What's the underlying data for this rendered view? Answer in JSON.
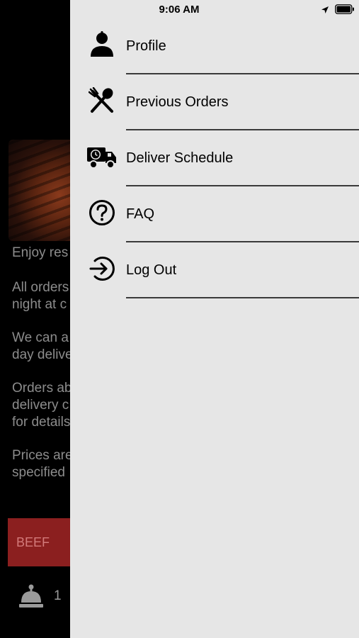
{
  "status_bar": {
    "time": "9:06 AM"
  },
  "menu": {
    "items": [
      {
        "label": "Profile",
        "icon": "person-icon"
      },
      {
        "label": "Previous Orders",
        "icon": "fork-spoon-icon"
      },
      {
        "label": "Deliver Schedule",
        "icon": "delivery-truck-icon"
      },
      {
        "label": "FAQ",
        "icon": "question-circle-icon"
      },
      {
        "label": "Log Out",
        "icon": "logout-icon"
      }
    ]
  },
  "background": {
    "paragraphs": [
      "Enjoy res",
      "All orders\nnight at c",
      "We can a\nday delive",
      "Orders ab\ndelivery c\nfor details",
      "Prices are\nspecified"
    ],
    "category_button": "BEEF",
    "cart_count": "1"
  },
  "colors": {
    "drawer_bg": "#e6e6e6",
    "category_bg": "#8b1f1f"
  }
}
